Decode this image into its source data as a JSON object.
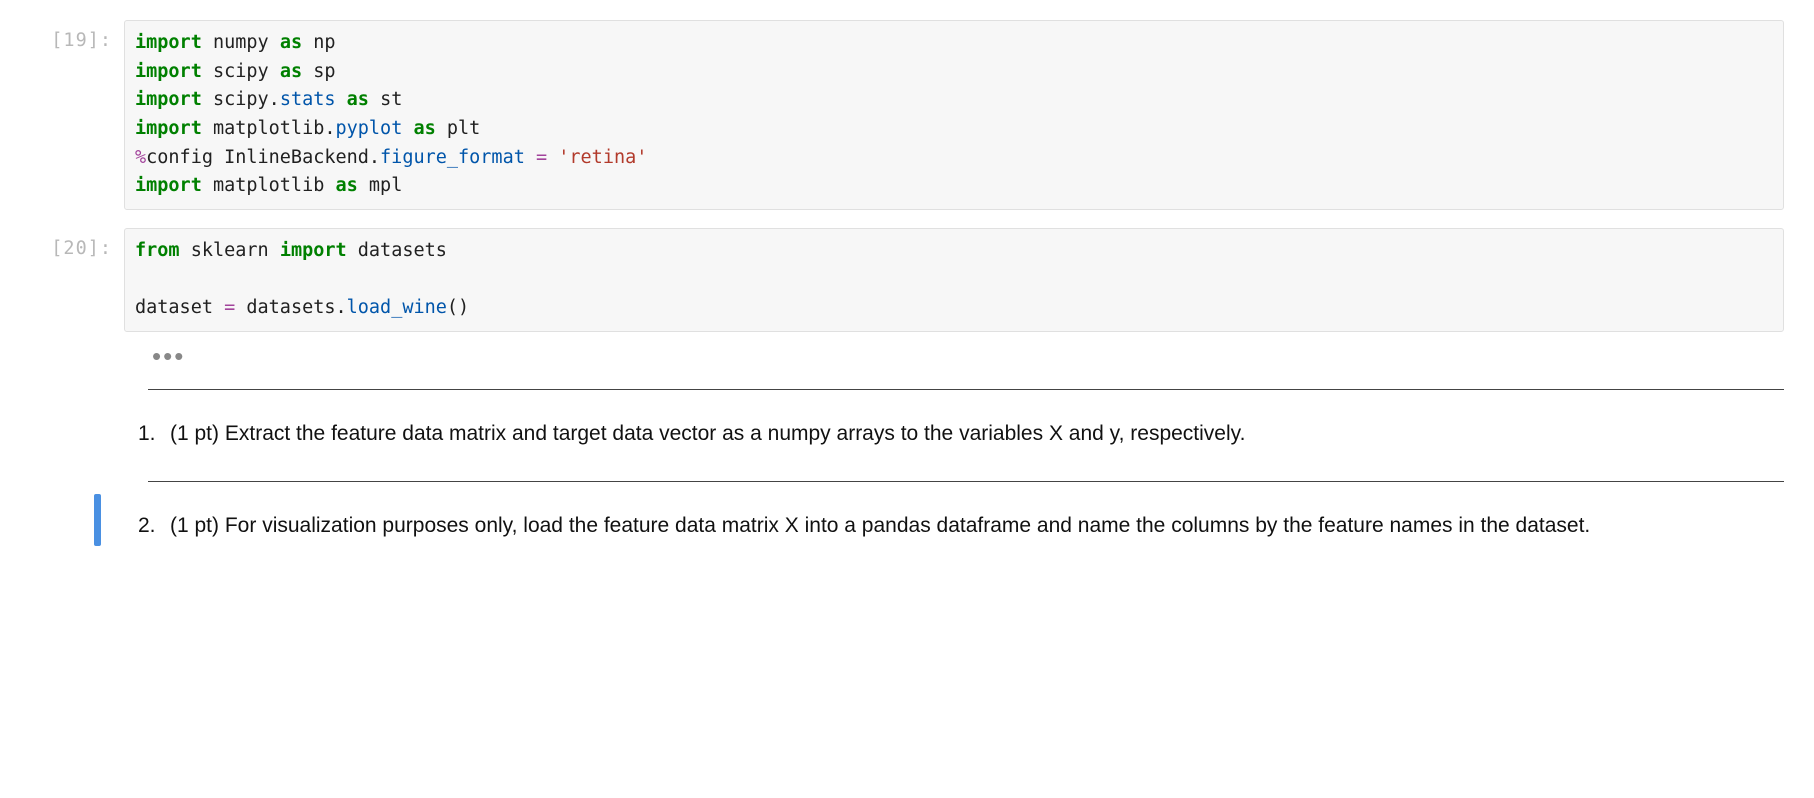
{
  "cells": [
    {
      "prompt": "[19]:",
      "tokens": [
        {
          "t": "import",
          "c": "kw-green"
        },
        {
          "t": " "
        },
        {
          "t": "numpy",
          "c": "name"
        },
        {
          "t": " "
        },
        {
          "t": "as",
          "c": "kw-green"
        },
        {
          "t": " "
        },
        {
          "t": "np",
          "c": "name"
        },
        {
          "t": "\n"
        },
        {
          "t": "import",
          "c": "kw-green"
        },
        {
          "t": " "
        },
        {
          "t": "scipy",
          "c": "name"
        },
        {
          "t": " "
        },
        {
          "t": "as",
          "c": "kw-green"
        },
        {
          "t": " "
        },
        {
          "t": "sp",
          "c": "name"
        },
        {
          "t": "\n"
        },
        {
          "t": "import",
          "c": "kw-green"
        },
        {
          "t": " "
        },
        {
          "t": "scipy",
          "c": "name"
        },
        {
          "t": ".",
          "c": "name"
        },
        {
          "t": "stats",
          "c": "attr-blue"
        },
        {
          "t": " "
        },
        {
          "t": "as",
          "c": "kw-green"
        },
        {
          "t": " "
        },
        {
          "t": "st",
          "c": "name"
        },
        {
          "t": "\n"
        },
        {
          "t": "import",
          "c": "kw-green"
        },
        {
          "t": " "
        },
        {
          "t": "matplotlib",
          "c": "name"
        },
        {
          "t": ".",
          "c": "name"
        },
        {
          "t": "pyplot",
          "c": "attr-blue"
        },
        {
          "t": " "
        },
        {
          "t": "as",
          "c": "kw-green"
        },
        {
          "t": " "
        },
        {
          "t": "plt",
          "c": "name"
        },
        {
          "t": "\n"
        },
        {
          "t": "%",
          "c": "magic-purple"
        },
        {
          "t": "config",
          "c": "name"
        },
        {
          "t": " "
        },
        {
          "t": "InlineBackend",
          "c": "name"
        },
        {
          "t": ".",
          "c": "name"
        },
        {
          "t": "figure_format",
          "c": "attr-blue"
        },
        {
          "t": " "
        },
        {
          "t": "=",
          "c": "op"
        },
        {
          "t": " "
        },
        {
          "t": "'retina'",
          "c": "string-red"
        },
        {
          "t": "\n"
        },
        {
          "t": "import",
          "c": "kw-green"
        },
        {
          "t": " "
        },
        {
          "t": "matplotlib",
          "c": "name"
        },
        {
          "t": " "
        },
        {
          "t": "as",
          "c": "kw-green"
        },
        {
          "t": " "
        },
        {
          "t": "mpl",
          "c": "name"
        }
      ]
    },
    {
      "prompt": "[20]:",
      "tokens": [
        {
          "t": "from",
          "c": "kw-green"
        },
        {
          "t": " "
        },
        {
          "t": "sklearn",
          "c": "name"
        },
        {
          "t": " "
        },
        {
          "t": "import",
          "c": "kw-green"
        },
        {
          "t": " "
        },
        {
          "t": "datasets",
          "c": "name"
        },
        {
          "t": "\n"
        },
        {
          "t": "\n"
        },
        {
          "t": "dataset",
          "c": "name"
        },
        {
          "t": " "
        },
        {
          "t": "=",
          "c": "op"
        },
        {
          "t": " "
        },
        {
          "t": "datasets",
          "c": "name"
        },
        {
          "t": ".",
          "c": "name"
        },
        {
          "t": "load_wine",
          "c": "attr-blue"
        },
        {
          "t": "(",
          "c": "paren"
        },
        {
          "t": ")",
          "c": "paren"
        }
      ]
    }
  ],
  "ellipsis": "•••",
  "markdown": {
    "items": [
      {
        "num": "1.",
        "pts": "(1 pt)",
        "text": "Extract the feature data matrix and target data vector as a numpy arrays to the variables X and y, respectively."
      },
      {
        "num": "2.",
        "pts": "(1 pt)",
        "text": "For visualization purposes only, load the feature data matrix X into a pandas dataframe and name the columns by the feature names in the dataset."
      }
    ]
  }
}
